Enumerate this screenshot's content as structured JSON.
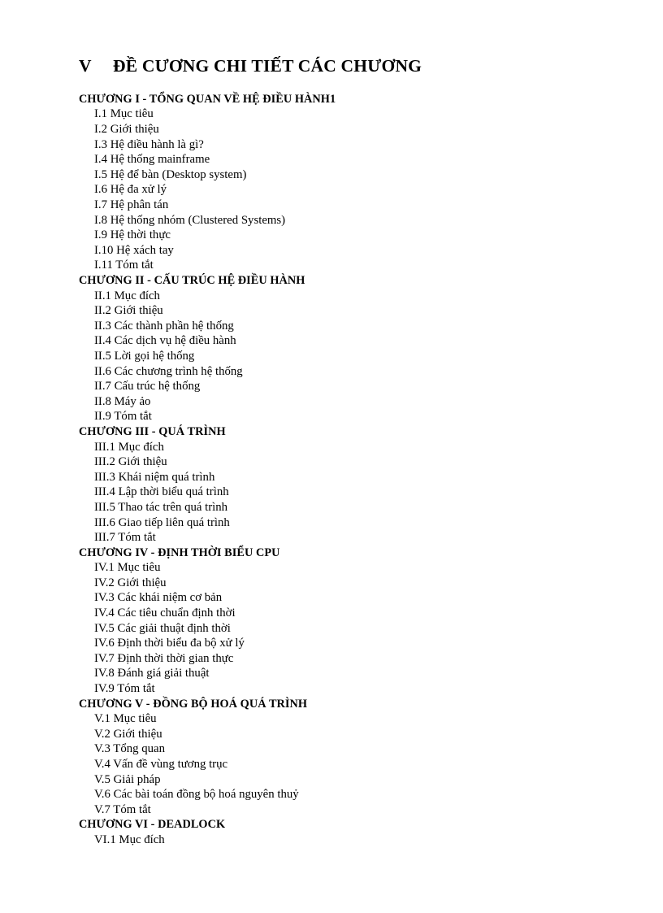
{
  "document": {
    "title_numeral": "V",
    "title_text": "ĐỀ CƯƠNG CHI TIẾT CÁC CHƯƠNG",
    "chapters": [
      {
        "heading": "CHƯƠNG I - TỔNG QUAN VỀ HỆ ĐIỀU HÀNH1",
        "sections": [
          "I.1 Mục tiêu",
          "I.2 Giới thiệu",
          "I.3 Hệ điều hành là gì?",
          "I.4 Hệ thống mainframe",
          "I.5 Hệ để bàn (Desktop system)",
          "I.6 Hệ đa xử lý",
          "I.7 Hệ phân tán",
          "I.8 Hệ thống nhóm (Clustered Systems)",
          "I.9 Hệ thời thực",
          "I.10 Hệ xách tay",
          "I.11 Tóm tắt"
        ]
      },
      {
        "heading": "CHƯƠNG II - CẤU TRÚC HỆ ĐIỀU HÀNH",
        "sections": [
          "II.1 Mục đích",
          "II.2 Giới thiệu",
          "II.3 Các thành phần hệ thống",
          "II.4 Các dịch vụ hệ điều hành",
          "II.5 Lời gọi hệ thống",
          "II.6 Các chương trình hệ thống",
          "II.7 Cấu trúc hệ thống",
          "II.8 Máy ảo",
          "II.9 Tóm tắt"
        ]
      },
      {
        "heading": "CHƯƠNG III - QUÁ TRÌNH",
        "sections": [
          "III.1 Mục đích",
          "III.2 Giới thiệu",
          "III.3 Khái niệm quá trình",
          "III.4 Lập thời biểu quá trình",
          "III.5 Thao tác trên quá trình",
          "III.6 Giao tiếp liên quá trình",
          "III.7 Tóm tắt"
        ]
      },
      {
        "heading": "CHƯƠNG IV - ĐỊNH THỜI BIỂU CPU",
        "sections": [
          "IV.1 Mục tiêu",
          "IV.2 Giới thiệu",
          "IV.3 Các khái niệm cơ bản",
          "IV.4 Các tiêu chuẩn định thời",
          "IV.5 Các giải thuật định thời",
          "IV.6 Định thời biểu đa bộ xử lý",
          "IV.7 Định thời thời gian thực",
          "IV.8 Đánh giá giải thuật",
          "IV.9 Tóm tắt"
        ]
      },
      {
        "heading": "CHƯƠNG V - ĐỒNG BỘ HOÁ QUÁ TRÌNH",
        "sections": [
          "V.1 Mục tiêu",
          "V.2 Giới thiệu",
          "V.3 Tổng quan",
          "V.4 Vấn đề vùng tương trục",
          "V.5 Giải pháp",
          "V.6 Các bài toán đồng bộ hoá nguyên thuỷ",
          "V.7 Tóm tắt"
        ]
      },
      {
        "heading": "CHƯƠNG VI - DEADLOCK",
        "sections": [
          "VI.1 Mục đích"
        ]
      }
    ]
  }
}
